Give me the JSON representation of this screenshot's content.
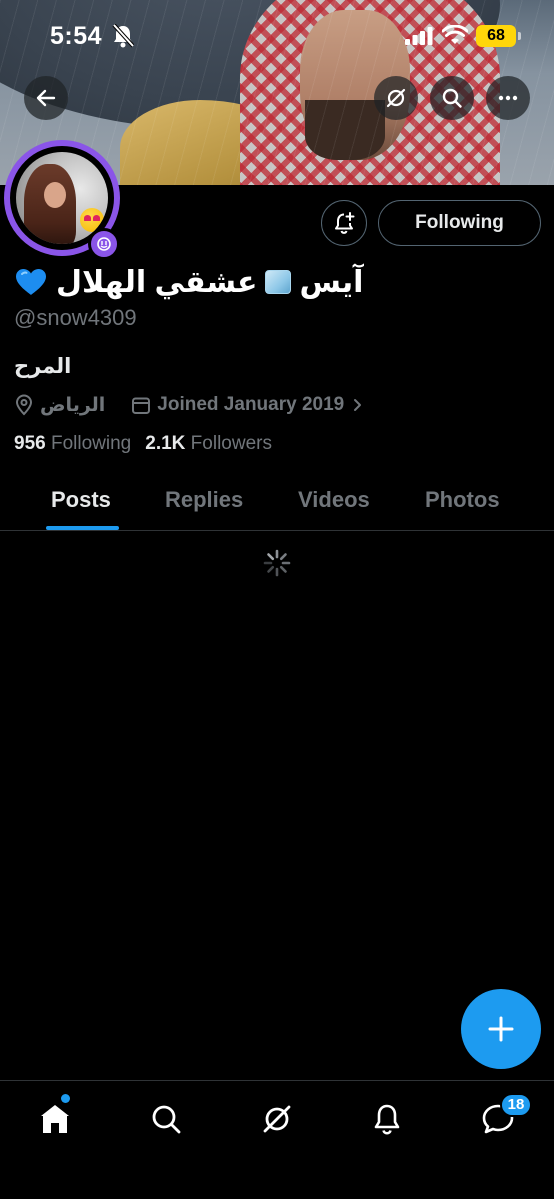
{
  "status_bar": {
    "time": "5:54",
    "battery": "68",
    "battery_color": "#ffd60a"
  },
  "header": {
    "back_icon": "arrow-left-icon",
    "grok_icon": "grok-icon",
    "search_icon": "search-icon",
    "more_icon": "more-horizontal-icon"
  },
  "profile": {
    "display_name": "آيس",
    "display_name_2": "عشقي الهلال",
    "handle": "@snow4309",
    "bio": "المرح",
    "location": "الرياض",
    "joined": "Joined January 2019",
    "following_count": "956",
    "following_label": "Following",
    "followers_count": "2.1K",
    "followers_label": "Followers",
    "follow_button": "Following",
    "ring_color": "#8a55e8"
  },
  "tabs": [
    {
      "label": "Posts",
      "active": true
    },
    {
      "label": "Replies",
      "active": false
    },
    {
      "label": "Videos",
      "active": false
    },
    {
      "label": "Photos",
      "active": false
    }
  ],
  "bottom_nav": {
    "items": [
      "home-icon",
      "search-icon",
      "grok-icon",
      "notifications-icon",
      "messages-icon"
    ],
    "messages_badge": "18"
  },
  "colors": {
    "accent": "#1d9bf0",
    "background": "#000000",
    "secondary_text": "#71767b"
  }
}
